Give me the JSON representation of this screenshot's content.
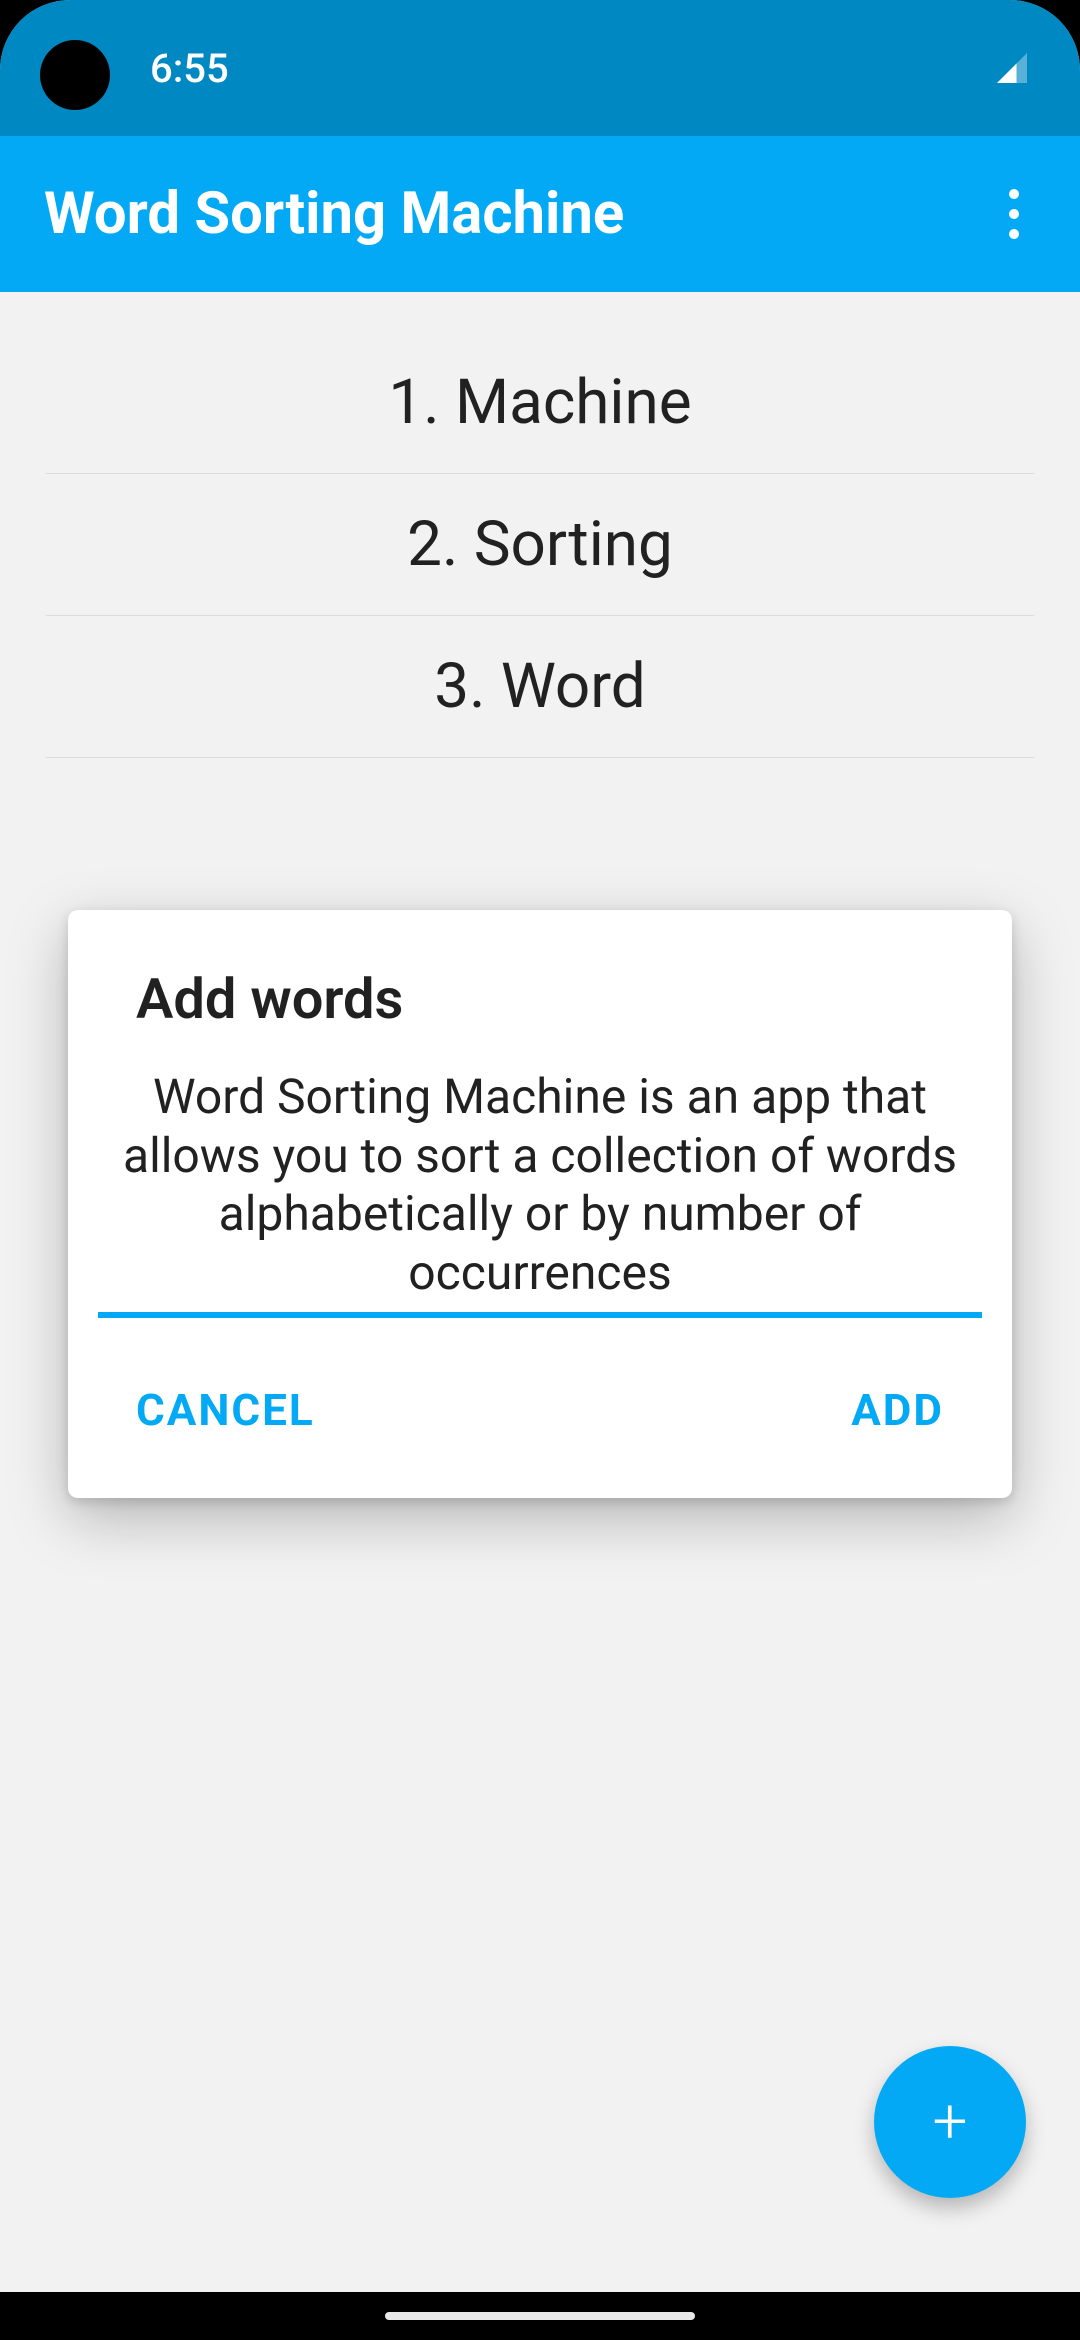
{
  "status": {
    "time": "6:55"
  },
  "appbar": {
    "title": "Word Sorting Machine"
  },
  "words": {
    "items": [
      {
        "label": "1. Machine"
      },
      {
        "label": "2. Sorting"
      },
      {
        "label": "3. Word"
      }
    ]
  },
  "dialog": {
    "title": "Add words",
    "input_value": "Word Sorting Machine is an app that allows you to sort a collection of words alphabetically or by number of occurrences",
    "cancel_label": "CANCEL",
    "add_label": "ADD"
  },
  "fab": {
    "plus": "+"
  }
}
